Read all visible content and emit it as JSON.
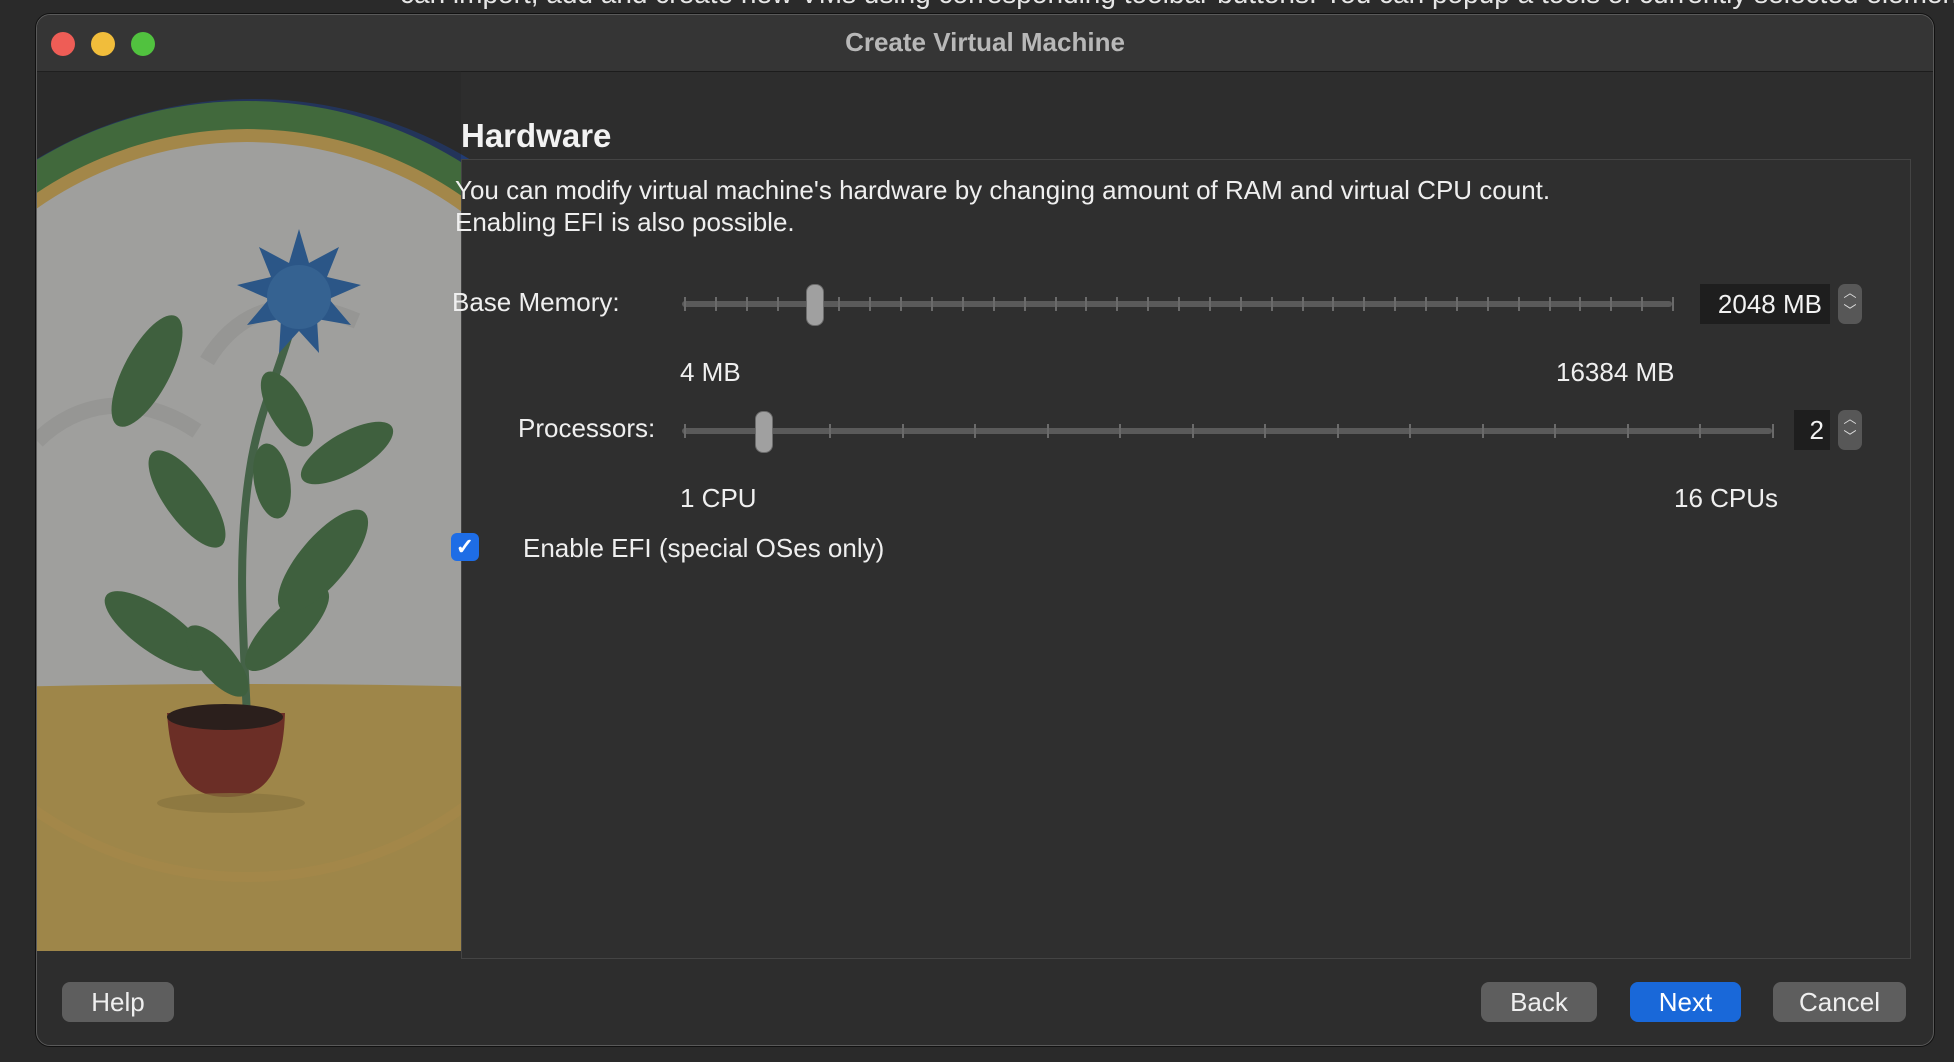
{
  "background_text": "can import, add and create new VMs using corresponding toolbar buttons. You can popup a tools of currently selected element us",
  "window": {
    "title": "Create Virtual Machine"
  },
  "hardware": {
    "section_title": "Hardware",
    "description_line1": "You can modify virtual machine's hardware by changing amount of RAM and virtual CPU count.",
    "description_line2": "Enabling EFI is also possible.",
    "base_memory": {
      "label": "Base Memory:",
      "value": "2048 MB",
      "value_mb": 2048,
      "min_label": "4 MB",
      "max_label": "16384 MB",
      "min": 4,
      "max": 16384
    },
    "processors": {
      "label": "Processors:",
      "value": "2",
      "value_count": 2,
      "min_label": "1 CPU",
      "max_label": "16 CPUs",
      "min": 1,
      "max": 16
    },
    "efi": {
      "label": "Enable EFI (special OSes only)",
      "checked": true
    }
  },
  "buttons": {
    "help": "Help",
    "back": "Back",
    "next": "Next",
    "cancel": "Cancel"
  },
  "colors": {
    "accent": "#1968d9",
    "close": "#ee5d56",
    "minimize": "#f1bd3b",
    "zoom": "#51c23f"
  },
  "icons": {
    "close": "close-icon",
    "minimize": "minimize-icon",
    "zoom": "zoom-icon",
    "check": "checkmark-icon",
    "spin_up": "chevron-up-icon",
    "spin_down": "chevron-down-icon"
  }
}
